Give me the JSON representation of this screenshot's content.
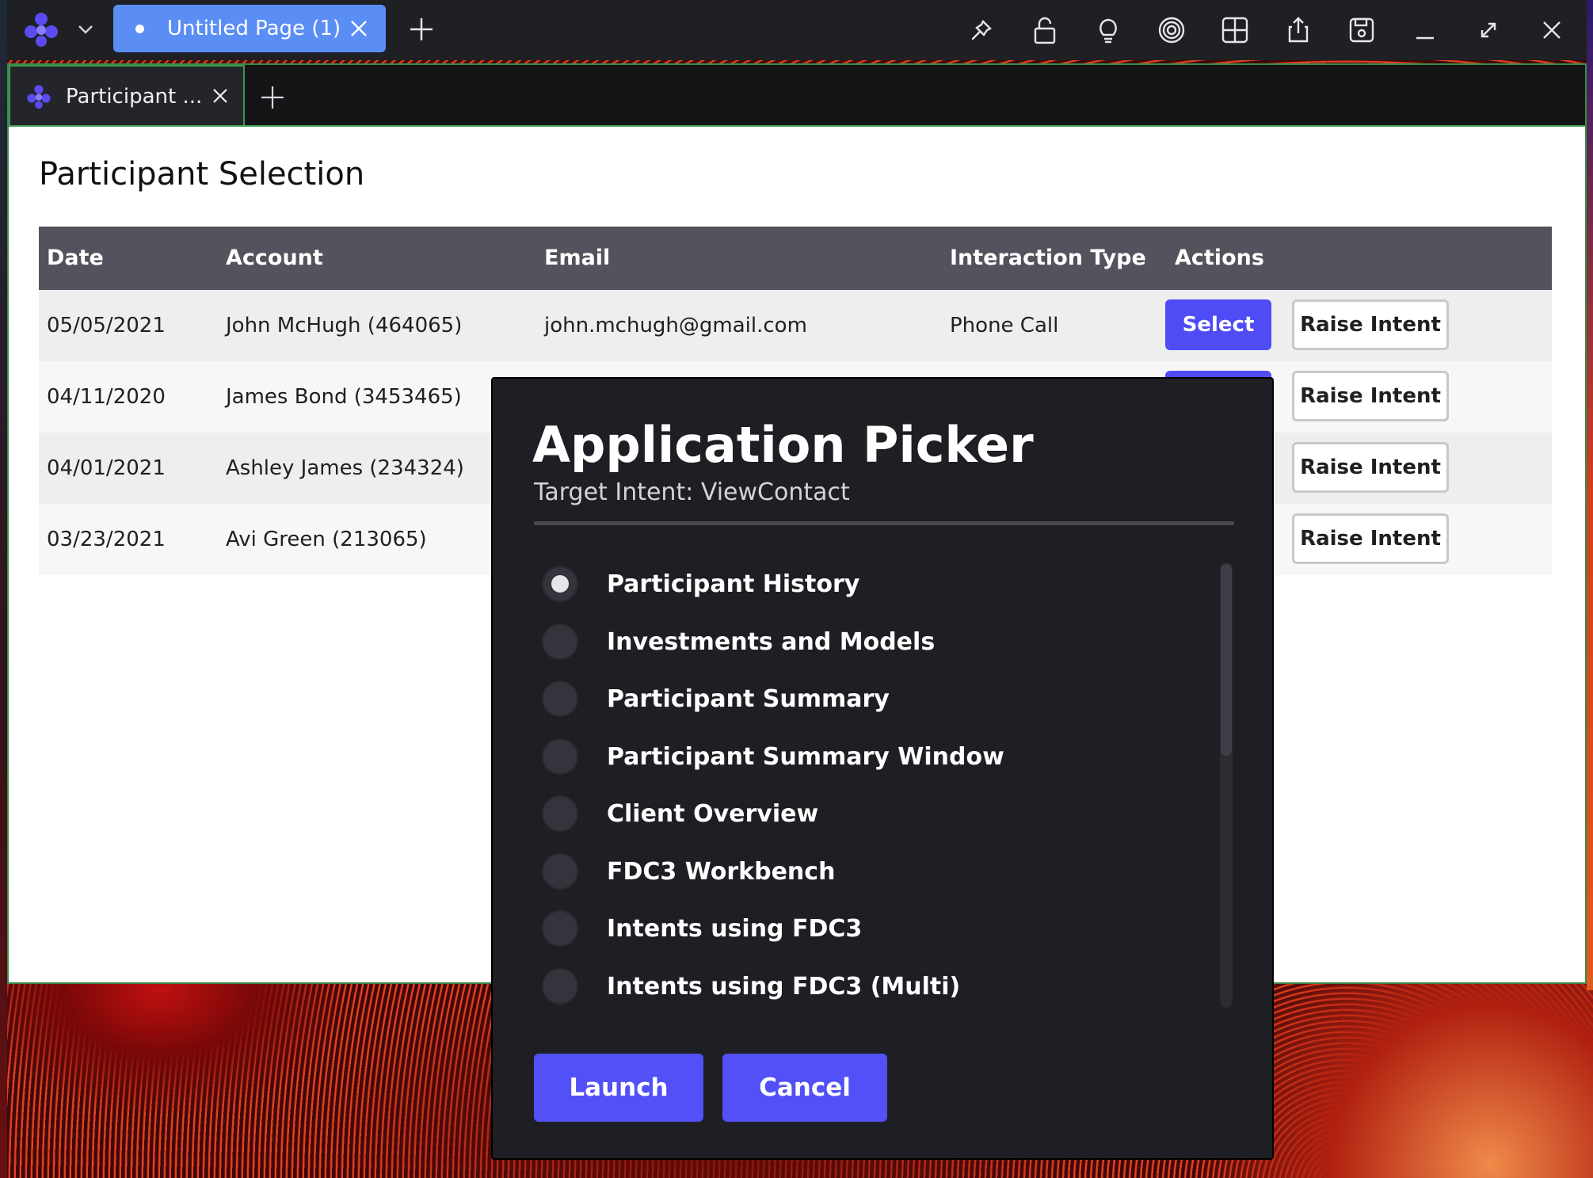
{
  "topbar": {
    "page_tab_label": "Untitled Page (1)",
    "icons": [
      "pin-icon",
      "lock-icon",
      "lightbulb-icon",
      "target-icon",
      "grid-icon",
      "share-icon",
      "save-icon",
      "minimize-icon",
      "maximize-icon",
      "close-icon"
    ]
  },
  "window": {
    "tab_label": "Participant ...",
    "page_title": "Participant Selection"
  },
  "table": {
    "headers": [
      "Date",
      "Account",
      "Email",
      "Interaction Type",
      "Actions"
    ],
    "rows": [
      {
        "date": "05/05/2021",
        "account": "John McHugh (464065)",
        "email": "john.mchugh@gmail.com",
        "interaction": "Phone Call"
      },
      {
        "date": "04/11/2020",
        "account": "James Bond (3453465)",
        "email": "",
        "interaction": ""
      },
      {
        "date": "04/01/2021",
        "account": "Ashley James (234324)",
        "email": "",
        "interaction": ""
      },
      {
        "date": "03/23/2021",
        "account": "Avi Green (213065)",
        "email": "",
        "interaction": ""
      }
    ],
    "select_label": "Select",
    "raise_label": "Raise Intent"
  },
  "dialog": {
    "title": "Application Picker",
    "subtitle": "Target Intent: ViewContact",
    "options": [
      {
        "label": "Participant History",
        "selected": true
      },
      {
        "label": "Investments and Models",
        "selected": false
      },
      {
        "label": "Participant Summary",
        "selected": false
      },
      {
        "label": "Participant Summary Window",
        "selected": false
      },
      {
        "label": "Client Overview",
        "selected": false
      },
      {
        "label": "FDC3 Workbench",
        "selected": false
      },
      {
        "label": "Intents using FDC3",
        "selected": false
      },
      {
        "label": "Intents using FDC3 (Multi)",
        "selected": false
      }
    ],
    "launch_label": "Launch",
    "cancel_label": "Cancel"
  },
  "colors": {
    "accent": "#4f4cf6",
    "page_tab": "#5b8ef5",
    "window_border": "#3a9a4a",
    "dialog_bg": "#1e1f24",
    "header_bg": "#52535c"
  }
}
